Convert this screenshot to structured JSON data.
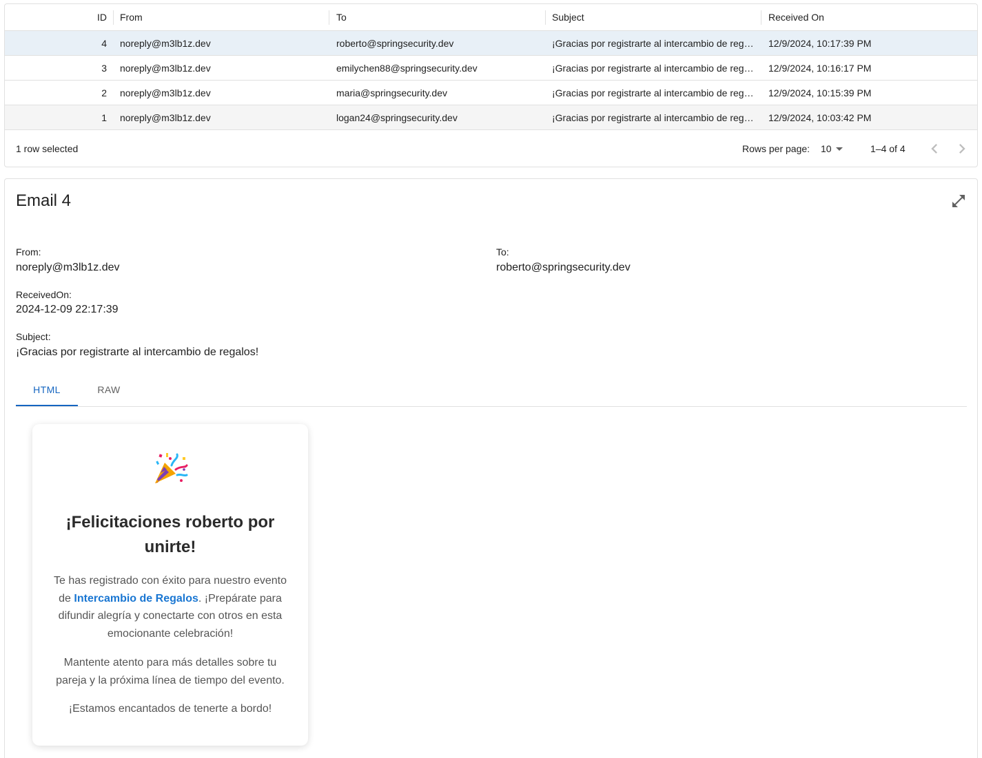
{
  "grid": {
    "columns": {
      "id": "ID",
      "from": "From",
      "to": "To",
      "subject": "Subject",
      "received": "Received On"
    },
    "rows": [
      {
        "id": "4",
        "from": "noreply@m3lb1z.dev",
        "to": "roberto@springsecurity.dev",
        "subject": "¡Gracias por registrarte al intercambio de regalos!",
        "received": "12/9/2024, 10:17:39 PM"
      },
      {
        "id": "3",
        "from": "noreply@m3lb1z.dev",
        "to": "emilychen88@springsecurity.dev",
        "subject": "¡Gracias por registrarte al intercambio de regalos!",
        "received": "12/9/2024, 10:16:17 PM"
      },
      {
        "id": "2",
        "from": "noreply@m3lb1z.dev",
        "to": "maria@springsecurity.dev",
        "subject": "¡Gracias por registrarte al intercambio de regalos!",
        "received": "12/9/2024, 10:15:39 PM"
      },
      {
        "id": "1",
        "from": "noreply@m3lb1z.dev",
        "to": "logan24@springsecurity.dev",
        "subject": "¡Gracias por registrarte al intercambio de regalos!",
        "received": "12/9/2024, 10:03:42 PM"
      }
    ],
    "footer": {
      "selected_text": "1 row selected",
      "rows_per_page_label": "Rows per page:",
      "rows_per_page_value": "10",
      "range_text": "1–4 of 4"
    }
  },
  "detail": {
    "title": "Email 4",
    "from_label": "From:",
    "from_value": "noreply@m3lb1z.dev",
    "to_label": "To:",
    "to_value": "roberto@springsecurity.dev",
    "received_label": "ReceivedOn:",
    "received_value": "2024-12-09 22:17:39",
    "subject_label": "Subject:",
    "subject_value": "¡Gracias por registrarte al intercambio de regalos!",
    "tabs": {
      "html": "HTML",
      "raw": "RAW"
    },
    "expand_icon": "expand-icon"
  },
  "email": {
    "icon": "party-popper-icon",
    "title": "¡Felicitaciones roberto por unirte!",
    "p1_before": "Te has registrado con éxito para nuestro evento de ",
    "p1_brand": "Intercambio de Regalos",
    "p1_after": ". ¡Prepárate para difundir alegría y conectarte con otros en esta emocionante celebración!",
    "p2": "Mantente atento para más detalles sobre tu pareja y la próxima línea de tiempo del evento.",
    "p3": "¡Estamos encantados de tenerte a bordo!"
  },
  "colors": {
    "selected_row": "#e8f0f7",
    "accent": "#1565c0",
    "brand_link": "#1976d2"
  }
}
